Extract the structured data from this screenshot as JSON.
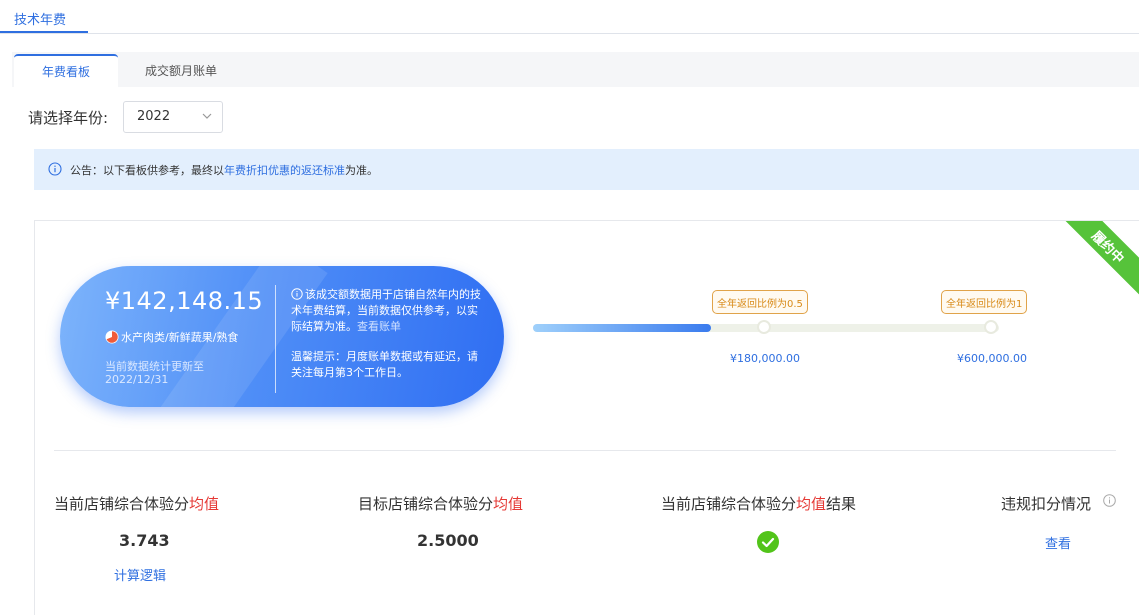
{
  "top_tab": {
    "label": "技术年费"
  },
  "sub_tabs": [
    {
      "label": "年费看板",
      "active": true
    },
    {
      "label": "成交额月账单",
      "active": false
    }
  ],
  "year_filter": {
    "label": "请选择年份:",
    "value": "2022"
  },
  "notice": {
    "prefix": "公告：以下看板供参考，最终以",
    "link": "年费折扣优惠的返还标准",
    "suffix": "为准。"
  },
  "status_ribbon": "履约中",
  "summary": {
    "amount": "¥142,148.15",
    "category": "水产肉类/新鲜蔬果/熟食",
    "update_line1": "当前数据统计更新至",
    "update_line2": "2022/12/31",
    "note": "该成交额数据用于店铺自然年内的技术年费结算，当前数据仅供参考，以实际结算为准。",
    "note_link": "查看账单",
    "tip": "温馨提示：月度账单数据或有延迟，请关注每月第3个工作日。"
  },
  "progress": {
    "current_ratio": 0.3821,
    "milestones": [
      {
        "badge": "全年返回比例为0.5",
        "value": "¥180,000.00"
      },
      {
        "badge": "全年返回比例为1",
        "value": "¥600,000.00"
      }
    ]
  },
  "metrics": [
    {
      "label_pre": "当前店铺综合体验分",
      "label_hl": "均值",
      "label_post": "",
      "value": "3.743",
      "link": "计算逻辑"
    },
    {
      "label_pre": "目标店铺综合体验分",
      "label_hl": "均值",
      "label_post": "",
      "value": "2.5000"
    },
    {
      "label_pre": "当前店铺综合体验分",
      "label_hl": "均值",
      "label_post": "结果",
      "status": "pass"
    },
    {
      "label_pre": "违规扣分情况",
      "link": "查看"
    }
  ],
  "colors": {
    "accent": "#2f6fe0",
    "highlight": "#e53935",
    "success": "#52c41a",
    "ribbon": "#56c33a",
    "badge": "#d88a18"
  }
}
